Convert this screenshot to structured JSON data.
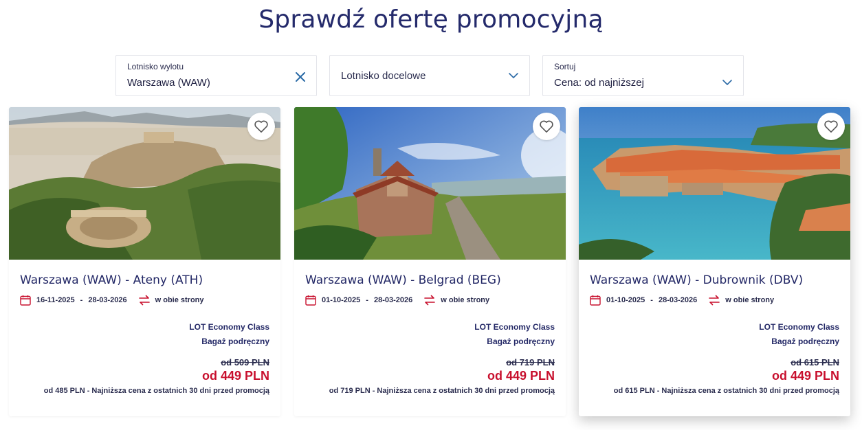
{
  "page_title": "Sprawdź ofertę promocyjną",
  "filters": {
    "departure": {
      "label": "Lotnisko wylotu",
      "value": "Warszawa (WAW)"
    },
    "destination": {
      "placeholder": "Lotnisko docelowe"
    },
    "sort": {
      "label": "Sortuj",
      "value": "Cena: od najniższej"
    }
  },
  "colors": {
    "brand": "#242a6b",
    "price": "#c8102e",
    "accent_icon": "#c8102e"
  },
  "offers": [
    {
      "route": "Warszawa (WAW) - Ateny (ATH)",
      "date_from": "16-11-2025",
      "date_sep": "-",
      "date_to": "28-03-2026",
      "trip_type": "w obie strony",
      "cabin": "LOT Economy Class",
      "baggage": "Bagaż podręczny",
      "old_price": "od 509 PLN",
      "price": "od 449 PLN",
      "note": "od 485 PLN - Najniższa cena z ostatnich 30 dni przed promocją"
    },
    {
      "route": "Warszawa (WAW) - Belgrad (BEG)",
      "date_from": "01-10-2025",
      "date_sep": "-",
      "date_to": "28-03-2026",
      "trip_type": "w obie strony",
      "cabin": "LOT Economy Class",
      "baggage": "Bagaż podręczny",
      "old_price": "od 719 PLN",
      "price": "od 449 PLN",
      "note": "od 719 PLN - Najniższa cena z ostatnich 30 dni przed promocją"
    },
    {
      "route": "Warszawa (WAW) - Dubrownik (DBV)",
      "date_from": "01-10-2025",
      "date_sep": "-",
      "date_to": "28-03-2026",
      "trip_type": "w obie strony",
      "cabin": "LOT Economy Class",
      "baggage": "Bagaż podręczny",
      "old_price": "od 615 PLN",
      "price": "od 449 PLN",
      "note": "od 615 PLN - Najniższa cena z ostatnich 30 dni przed promocją"
    }
  ]
}
